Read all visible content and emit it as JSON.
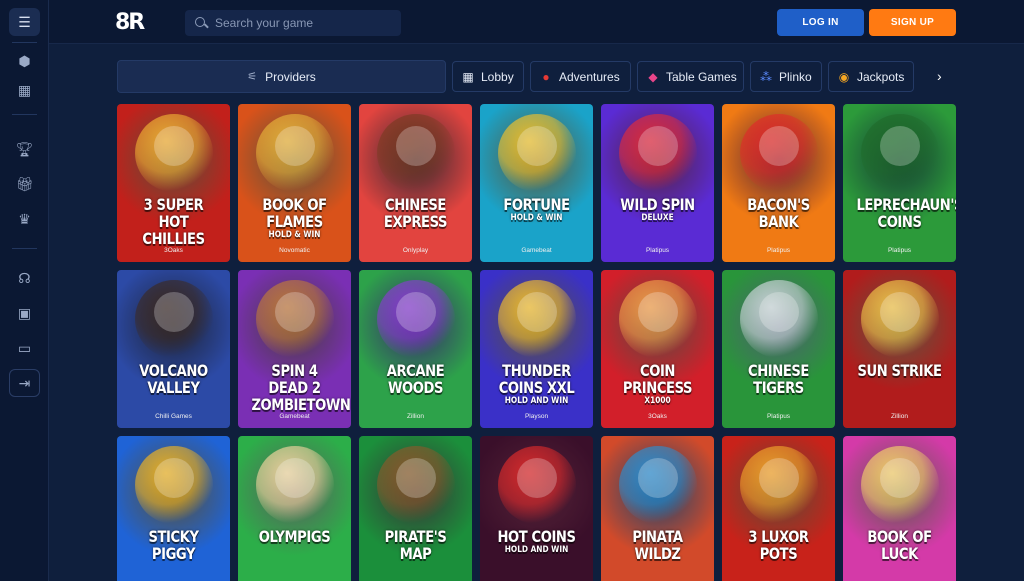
{
  "rail": {
    "icons": [
      "menu-icon",
      "level-badge-icon",
      "grid-icon",
      "trophy-icon",
      "gift-icon",
      "crown-icon",
      "headset-icon",
      "briefcase-icon",
      "book-icon",
      "exit-icon"
    ]
  },
  "header": {
    "logo": "8R",
    "search_placeholder": "Search your game",
    "login_label": "LOG IN",
    "signup_label": "SIGN UP"
  },
  "categories": {
    "providers_label": "Providers",
    "items": [
      {
        "label": "Lobby",
        "icon": "grid-icon"
      },
      {
        "label": "Adventures",
        "icon": "cherries-icon"
      },
      {
        "label": "Table Games",
        "icon": "dice-icon"
      },
      {
        "label": "Plinko",
        "icon": "plinko-icon"
      },
      {
        "label": "Jackpots",
        "icon": "coins-icon"
      }
    ]
  },
  "games": [
    {
      "title": "3 SUPER HOT CHILLIES",
      "sub": "",
      "provider": "3Oaks",
      "bg": "#c2201b",
      "accent": "#f2b233"
    },
    {
      "title": "BOOK OF FLAMES",
      "sub": "HOLD & WIN",
      "provider": "Novomatic",
      "bg": "#d9521a",
      "accent": "#e8b43a"
    },
    {
      "title": "CHINESE EXPRESS",
      "sub": "",
      "provider": "Onlyplay",
      "bg": "#e2443f",
      "accent": "#7a3a22"
    },
    {
      "title": "FORTUNE",
      "sub": "HOLD & WIN",
      "provider": "Gamebeat",
      "bg": "#1aa3c9",
      "accent": "#f3c22a"
    },
    {
      "title": "WILD SPIN",
      "sub": "DELUXE",
      "provider": "Platipus",
      "bg": "#5a2bd4",
      "accent": "#e42b3a"
    },
    {
      "title": "BACON'S BANK",
      "sub": "",
      "provider": "Platipus",
      "bg": "#f07a14",
      "accent": "#e02a2a"
    },
    {
      "title": "LEPRECHAUN'S COINS",
      "sub": "",
      "provider": "Platipus",
      "bg": "#2c9a3a",
      "accent": "#1f6b2a"
    },
    {
      "title": "VOLCANO VALLEY",
      "sub": "",
      "provider": "Chilli Games",
      "bg": "#2c4aa6",
      "accent": "#3b2a24"
    },
    {
      "title": "SPIN 4 DEAD 2 ZOMBIETOWN",
      "sub": "",
      "provider": "Gamebeat",
      "bg": "#7a2fb4",
      "accent": "#c07a3a"
    },
    {
      "title": "ARCANE WOODS",
      "sub": "",
      "provider": "Zillion",
      "bg": "#2da24a",
      "accent": "#8a3ad2"
    },
    {
      "title": "THUNDER COINS XXL",
      "sub": "HOLD AND WIN",
      "provider": "Playson",
      "bg": "#3a30c8",
      "accent": "#f5c02a"
    },
    {
      "title": "COIN PRINCESS",
      "sub": "X1000",
      "provider": "3Oaks",
      "bg": "#d21f2a",
      "accent": "#f2a24a"
    },
    {
      "title": "CHINESE TIGERS",
      "sub": "",
      "provider": "Platipus",
      "bg": "#29953a",
      "accent": "#cfd8dc"
    },
    {
      "title": "SUN STRIKE",
      "sub": "",
      "provider": "Zillion",
      "bg": "#b11c1c",
      "accent": "#f3c84a"
    },
    {
      "title": "STICKY PIGGY",
      "sub": "",
      "provider": "",
      "bg": "#1f63d6",
      "accent": "#f2b520"
    },
    {
      "title": "OLYMPIGS",
      "sub": "",
      "provider": "",
      "bg": "#2cae49",
      "accent": "#f4d6a0"
    },
    {
      "title": "PIRATE'S MAP",
      "sub": "",
      "provider": "",
      "bg": "#1b8f3b",
      "accent": "#8a5a2a"
    },
    {
      "title": "HOT COINS",
      "sub": "HOLD AND WIN",
      "provider": "",
      "bg": "#3a0f2a",
      "accent": "#e02a2a"
    },
    {
      "title": "PINATA WILDZ",
      "sub": "",
      "provider": "",
      "bg": "#d24a2a",
      "accent": "#2a8fd2"
    },
    {
      "title": "3 LUXOR POTS",
      "sub": "",
      "provider": "",
      "bg": "#c8221a",
      "accent": "#f3a62a"
    },
    {
      "title": "BOOK OF LUCK",
      "sub": "",
      "provider": "",
      "bg": "#d43aa8",
      "accent": "#f5d36a"
    }
  ]
}
